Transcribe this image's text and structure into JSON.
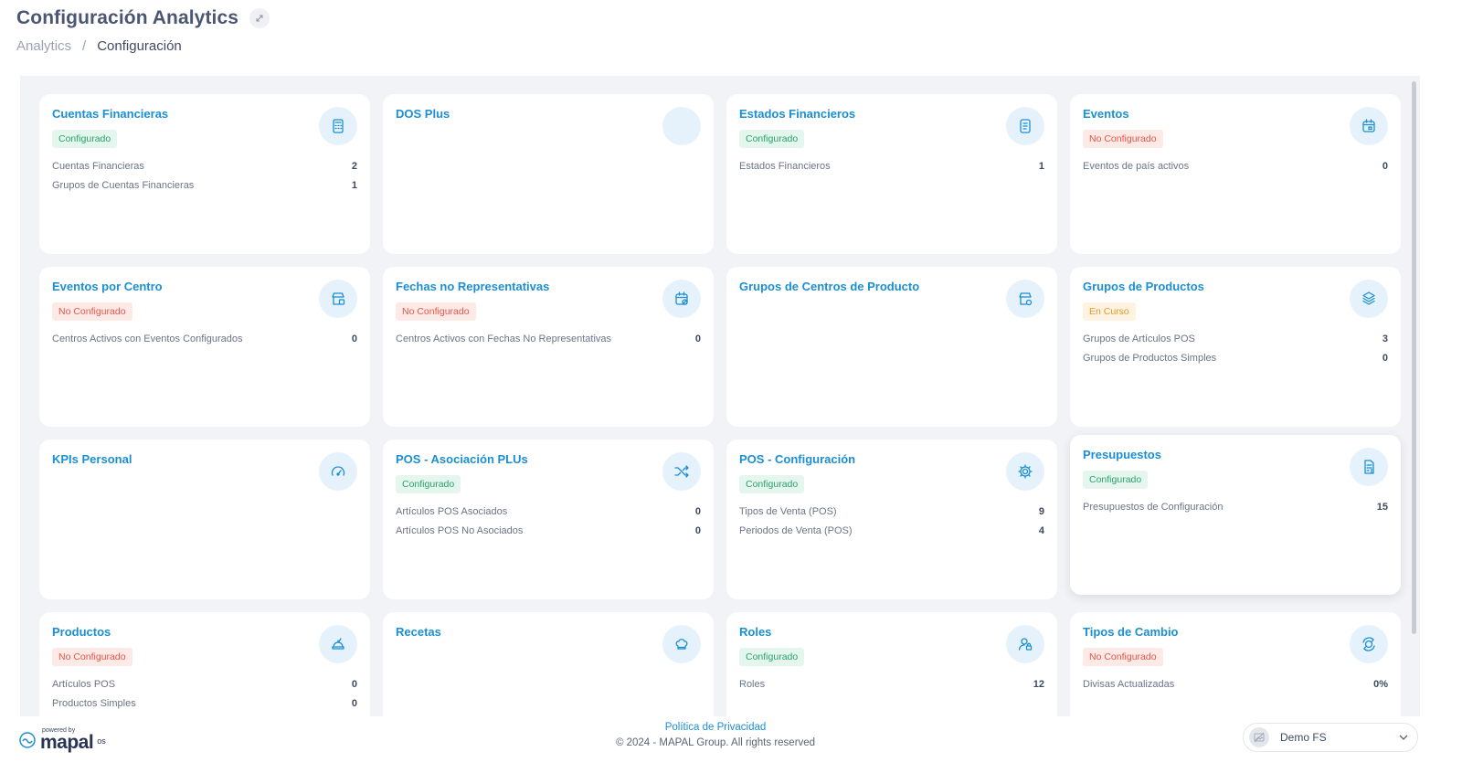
{
  "header": {
    "title": "Configuración Analytics",
    "breadcrumb": {
      "parent": "Analytics",
      "separator": "/",
      "current": "Configuración"
    }
  },
  "colors": {
    "accent": "#1b8fd1",
    "configured": "#2ca36b",
    "not_configured": "#e2584a",
    "in_progress": "#e29a2c"
  },
  "cards": [
    {
      "title": "Cuentas Financieras",
      "icon": "calculator-icon",
      "status": "Configurado",
      "status_type": "ok",
      "stats": [
        {
          "label": "Cuentas Financieras",
          "value": "2"
        },
        {
          "label": "Grupos de Cuentas Financieras",
          "value": "1"
        }
      ]
    },
    {
      "title": "DOS Plus",
      "icon": "",
      "status": "",
      "status_type": "",
      "stats": []
    },
    {
      "title": "Estados Financieros",
      "icon": "document-list-icon",
      "status": "Configurado",
      "status_type": "ok",
      "stats": [
        {
          "label": "Estados Financieros",
          "value": "1"
        }
      ]
    },
    {
      "title": "Eventos",
      "icon": "calendar-event-icon",
      "status": "No Configurado",
      "status_type": "no",
      "stats": [
        {
          "label": "Eventos de país activos",
          "value": "0"
        }
      ]
    },
    {
      "title": "Eventos por Centro",
      "icon": "store-calendar-icon",
      "status": "No Configurado",
      "status_type": "no",
      "stats": [
        {
          "label": "Centros Activos con Eventos Configurados",
          "value": "0"
        }
      ]
    },
    {
      "title": "Fechas no Representativas",
      "icon": "calendar-block-icon",
      "status": "No Configurado",
      "status_type": "no",
      "stats": [
        {
          "label": "Centros Activos con Fechas No Representativas",
          "value": "0"
        }
      ]
    },
    {
      "title": "Grupos de Centros de Producto",
      "icon": "store-settings-icon",
      "status": "",
      "status_type": "",
      "stats": []
    },
    {
      "title": "Grupos de Productos",
      "icon": "layers-icon",
      "status": "En Curso",
      "status_type": "pend",
      "stats": [
        {
          "label": "Grupos de Artículos POS",
          "value": "3"
        },
        {
          "label": "Grupos de Productos Simples",
          "value": "0"
        }
      ]
    },
    {
      "title": "KPIs Personal",
      "icon": "speedometer-icon",
      "status": "",
      "status_type": "",
      "stats": []
    },
    {
      "title": "POS - Asociación PLUs",
      "icon": "shuffle-icon",
      "status": "Configurado",
      "status_type": "ok",
      "stats": [
        {
          "label": "Artículos POS Asociados",
          "value": "0"
        },
        {
          "label": "Artículos POS No Asociados",
          "value": "0"
        }
      ]
    },
    {
      "title": "POS - Configuración",
      "icon": "gear-icon",
      "status": "Configurado",
      "status_type": "ok",
      "stats": [
        {
          "label": "Tipos de Venta (POS)",
          "value": "9"
        },
        {
          "label": "Periodos de Venta (POS)",
          "value": "4"
        }
      ]
    },
    {
      "title": "Presupuestos",
      "icon": "budget-document-icon",
      "status": "Configurado",
      "status_type": "ok",
      "stats": [
        {
          "label": "Presupuestos de Configuración",
          "value": "15"
        }
      ]
    },
    {
      "title": "Productos",
      "icon": "food-tray-icon",
      "status": "No Configurado",
      "status_type": "no",
      "stats": [
        {
          "label": "Artículos POS",
          "value": "0"
        },
        {
          "label": "Productos Simples",
          "value": "0"
        }
      ]
    },
    {
      "title": "Recetas",
      "icon": "chef-hat-icon",
      "status": "",
      "status_type": "",
      "stats": []
    },
    {
      "title": "Roles",
      "icon": "user-lock-icon",
      "status": "Configurado",
      "status_type": "ok",
      "stats": [
        {
          "label": "Roles",
          "value": "12"
        }
      ]
    },
    {
      "title": "Tipos de Cambio",
      "icon": "currency-exchange-icon",
      "status": "No Configurado",
      "status_type": "no",
      "stats": [
        {
          "label": "Divisas Actualizadas",
          "value": "0%"
        }
      ]
    }
  ],
  "footer": {
    "powered_by": "powered by",
    "logo": "mapal",
    "logo_suffix": "os",
    "privacy": "Política de Privacidad",
    "copyright": "© 2024 - MAPAL Group. All rights reserved",
    "user": "Demo FS"
  }
}
